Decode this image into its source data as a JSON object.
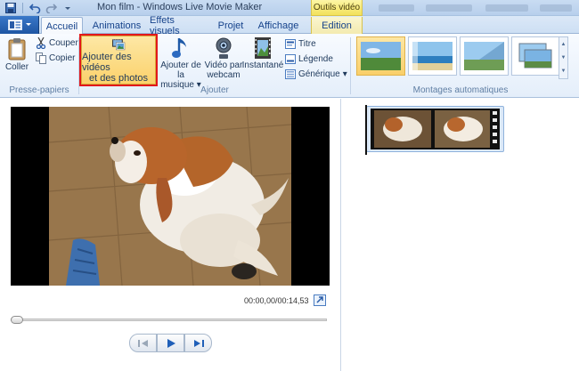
{
  "window": {
    "title": "Mon film - Windows Live Movie Maker",
    "context_tab_header": "Outils vidéo"
  },
  "tabs": [
    {
      "label": "Accueil",
      "active": true
    },
    {
      "label": "Animations",
      "active": false
    },
    {
      "label": "Effets visuels",
      "active": false
    },
    {
      "label": "Projet",
      "active": false
    },
    {
      "label": "Affichage",
      "active": false
    },
    {
      "label": "Edition",
      "active": false
    }
  ],
  "ribbon": {
    "clipboard": {
      "paste_label": "Coller",
      "cut_label": "Couper",
      "copy_label": "Copier",
      "group_label": "Presse-papiers"
    },
    "add": {
      "add_videos_label_1": "Ajouter des vidéos",
      "add_videos_label_2": "et des photos",
      "add_music_label_1": "Ajouter de la",
      "add_music_label_2": "musique",
      "webcam_label_1": "Vidéo par",
      "webcam_label_2": "webcam",
      "snapshot_label": "Instantané",
      "title_label": "Titre",
      "caption_label": "Légende",
      "credits_label": "Générique",
      "group_label": "Ajouter"
    },
    "automovie": {
      "group_label": "Montages automatiques"
    }
  },
  "preview": {
    "time": "00:00,00/00:14,53",
    "seek_position": 0
  },
  "colors": {
    "accent_highlight": "#e2181b",
    "ribbon_active": "#fbd16a",
    "video_background": "#000000"
  },
  "icons": {
    "app_menu": "app-menu-icon",
    "save": "save-icon",
    "undo": "undo-icon",
    "redo": "redo-icon",
    "paste": "clipboard-icon",
    "cut": "scissors-icon",
    "copy": "copy-icon",
    "add_videos": "film-photo-icon",
    "music": "music-note-icon",
    "webcam": "webcam-icon",
    "snapshot": "film-frame-icon",
    "play": "play-icon",
    "previous_frame": "previous-frame-icon",
    "next_frame": "next-frame-icon",
    "fullscreen": "expand-icon"
  }
}
